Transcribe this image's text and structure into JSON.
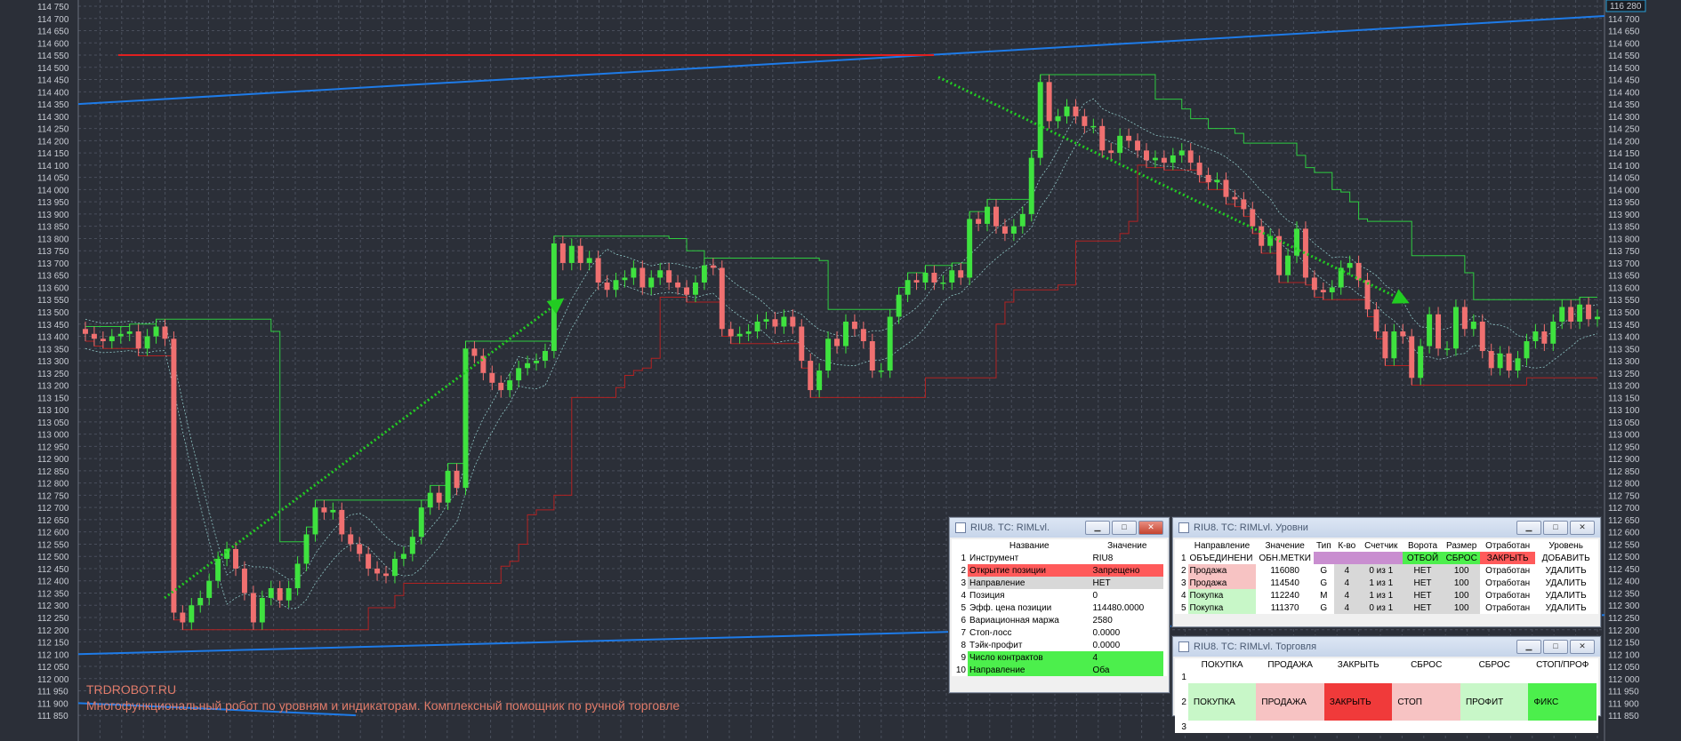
{
  "chart": {
    "y_axis_ticks": [
      "114 750",
      "114 700",
      "114 650",
      "114 600",
      "114 550",
      "114 500",
      "114 450",
      "114 400",
      "114 350",
      "114 300",
      "114 250",
      "114 200",
      "114 150",
      "114 100",
      "114 050",
      "114 000",
      "113 950",
      "113 900",
      "113 850",
      "113 800",
      "113 750",
      "113 700",
      "113 650",
      "113 600",
      "113 550",
      "113 500",
      "113 450",
      "113 400",
      "113 350",
      "113 300",
      "113 250",
      "113 200",
      "113 150",
      "113 100",
      "113 050",
      "113 000",
      "112 950",
      "112 900",
      "112 850",
      "112 800",
      "112 750",
      "112 700",
      "112 650",
      "112 600",
      "112 550",
      "112 500",
      "112 450",
      "112 400",
      "112 350",
      "112 300",
      "112 250",
      "112 200",
      "112 150",
      "112 100",
      "112 050",
      "112 000",
      "111 950",
      "111 900",
      "111 850"
    ],
    "current_price_label": "116 280",
    "colors": {
      "background": "#2b2f38",
      "grid": "#4a4f5c",
      "up": "#3fe23f",
      "down": "#f07070",
      "trendline": "#1e7be8",
      "level_red": "#e02020",
      "arrow": "#22cc22",
      "channel_green": "#2ecc40",
      "channel_red": "#b22222",
      "band": "#8fc6c6"
    }
  },
  "chart_data": {
    "type": "line",
    "ylim": [
      111850,
      114750
    ],
    "series": [
      {
        "values": [
          113410,
          113390,
          113380,
          113400,
          113410,
          113420,
          113350,
          113400,
          113440,
          113390,
          112270,
          112230,
          112300,
          112330,
          112400,
          112490,
          112530,
          112450,
          112350,
          112230,
          112330,
          112370,
          112320,
          112370,
          112470,
          112590,
          112700,
          112680,
          112690,
          112590,
          112550,
          112510,
          112450,
          112430,
          112420,
          112490,
          112510,
          112580,
          112700,
          112760,
          112720,
          112850,
          112780,
          113350,
          113320,
          113250,
          113210,
          113180,
          113220,
          113270,
          113290,
          113300,
          113340,
          113780,
          113700,
          113770,
          113700,
          113720,
          113620,
          113590,
          113630,
          113640,
          113680,
          113600,
          113640,
          113670,
          113620,
          113600,
          113570,
          113620,
          113690,
          113680,
          113430,
          113400,
          113410,
          113420,
          113460,
          113470,
          113440,
          113480,
          113440,
          113300,
          113180,
          113260,
          113390,
          113360,
          113460,
          113430,
          113380,
          113260,
          113260,
          113480,
          113570,
          113630,
          113620,
          113660,
          113620,
          113620,
          113670,
          113640,
          113880,
          113860,
          113930,
          113850,
          113820,
          113850,
          113900,
          114130,
          114440,
          114280,
          114300,
          114340,
          114300,
          114260,
          114260,
          114160,
          114150,
          114220,
          114200,
          114160,
          114120,
          114130,
          114110,
          114140,
          114160,
          114110,
          114060,
          114030,
          114040,
          113970,
          113960,
          113920,
          113850,
          113770,
          113810,
          113650,
          113730,
          113840,
          113640,
          113590,
          113580,
          113600,
          113680,
          113700,
          113630,
          113510,
          113420,
          113310,
          113420,
          113400,
          113230,
          113360,
          113490,
          113350,
          113350,
          113520,
          113430,
          113460,
          113340,
          113270,
          113330,
          113260,
          113310,
          113380,
          113420,
          113370,
          113460,
          113520,
          113460,
          113530,
          113470,
          113480
        ]
      }
    ]
  },
  "watermark": {
    "site": "TRDROBOT.RU",
    "slogan": "Многофункциональный робот по уровням и индикаторам. Комплексный помощник по ручной торговле"
  },
  "win_params": {
    "title": "RIU8. TC: RIMLvl.",
    "headers": [
      "Название",
      "Значение"
    ],
    "rows": [
      {
        "n": "1",
        "name": "Инструмент",
        "value": "RIU8",
        "hl": "none"
      },
      {
        "n": "2",
        "name": "Открытие позиции",
        "value": "Запрещено",
        "hl": "red"
      },
      {
        "n": "3",
        "name": "Направление",
        "value": "НЕТ",
        "hl": "gray"
      },
      {
        "n": "4",
        "name": "Позиция",
        "value": "0",
        "hl": "none"
      },
      {
        "n": "5",
        "name": "Эфф. цена позиции",
        "value": "114480.0000",
        "hl": "none"
      },
      {
        "n": "6",
        "name": "Вариационная маржа",
        "value": "2580",
        "hl": "none"
      },
      {
        "n": "7",
        "name": "Стоп-лосс",
        "value": "0.0000",
        "hl": "none"
      },
      {
        "n": "8",
        "name": "Тэйк-профит",
        "value": "0.0000",
        "hl": "none"
      },
      {
        "n": "9",
        "name": "Число контрактов",
        "value": "4",
        "hl": "green"
      },
      {
        "n": "10",
        "name": "Направление",
        "value": "Оба",
        "hl": "green"
      }
    ]
  },
  "win_levels": {
    "title": "RIU8. TC: RIMLvl. Уровни",
    "headers": [
      "Направление",
      "Значение",
      "Тип",
      "К-во",
      "Счетчик",
      "Ворота",
      "Размер",
      "Отработан",
      "Уровень"
    ],
    "rows": [
      [
        "ОБЪЕДИНЕНИ",
        "ОБН.МЕТКИ",
        "",
        "",
        "",
        "ОТБОЙ",
        "СБРОС",
        "ЗАКРЫТЬ",
        "ДОБАВИТЬ"
      ],
      [
        "Продажа",
        "116080",
        "G",
        "4",
        "0 из 1",
        "НЕТ",
        "100",
        "Отработан",
        "УДАЛИТЬ"
      ],
      [
        "Продажа",
        "114540",
        "G",
        "4",
        "1 из 1",
        "НЕТ",
        "100",
        "Отработан",
        "УДАЛИТЬ"
      ],
      [
        "Покупка",
        "112240",
        "M",
        "4",
        "1 из 1",
        "НЕТ",
        "100",
        "Отработан",
        "УДАЛИТЬ"
      ],
      [
        "Покупка",
        "111370",
        "G",
        "4",
        "0 из 1",
        "НЕТ",
        "100",
        "Отработан",
        "УДАЛИТЬ"
      ]
    ]
  },
  "win_trade": {
    "title": "RIU8. TC: RIMLvl. Торговля",
    "headers": [
      "ПОКУПКА",
      "ПРОДАЖА",
      "ЗАКРЫТЬ",
      "СБРОС",
      "СБРОС",
      "СТОП/ПРОФ"
    ],
    "buttons": [
      "ПОКУПКА",
      "ПРОДАЖА",
      "ЗАКРЫТЬ",
      "СТОП",
      "ПРОФИТ",
      "ФИКС"
    ]
  },
  "window_buttons": {
    "minimize": "▁",
    "maximize": "□",
    "close": "✕"
  }
}
